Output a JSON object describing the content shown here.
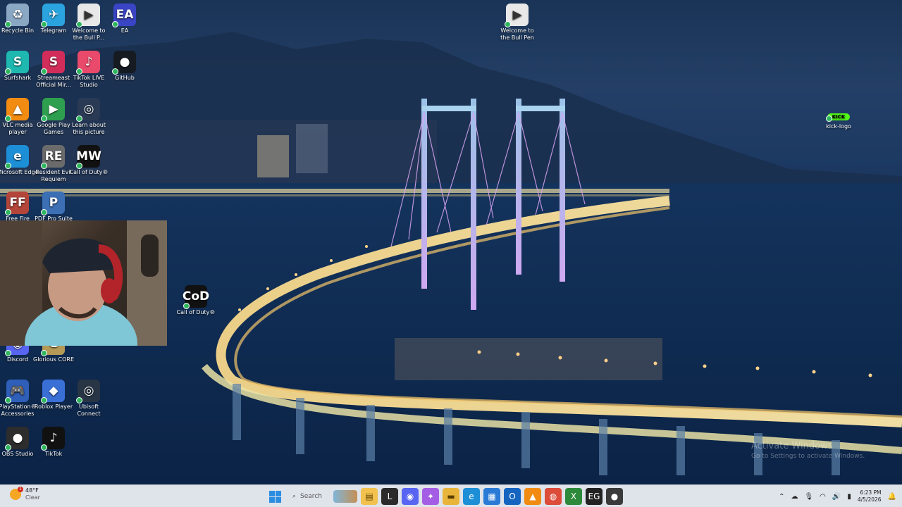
{
  "desktop": {
    "icons": [
      {
        "label": "Recycle Bin",
        "icon": "recycle-bin-icon",
        "color": "#8aa7c4",
        "glyph": "♻"
      },
      {
        "label": "Telegram",
        "icon": "telegram-icon",
        "color": "#2aa3df",
        "glyph": "✈"
      },
      {
        "label": "Welcome to the Bull P...",
        "icon": "video-file-icon",
        "color": "#e8e8e8",
        "glyph": "▶"
      },
      {
        "label": "EA",
        "icon": "ea-icon",
        "color": "#3a45c6",
        "glyph": "EA"
      },
      {
        "label": "Surfshark",
        "icon": "surfshark-icon",
        "color": "#1eb8b0",
        "glyph": "S"
      },
      {
        "label": "Streameast Official Mir...",
        "icon": "streameast-icon",
        "color": "#d22d5a",
        "glyph": "S"
      },
      {
        "label": "TikTok LIVE Studio",
        "icon": "tiktok-live-icon",
        "color": "#e9496a",
        "glyph": "♪"
      },
      {
        "label": "GitHub",
        "icon": "github-icon",
        "color": "#161b22",
        "glyph": "●"
      },
      {
        "label": "VLC media player",
        "icon": "vlc-icon",
        "color": "#f18b12",
        "glyph": "▲"
      },
      {
        "label": "Google Play Games",
        "icon": "google-play-games-icon",
        "color": "#2e9f4f",
        "glyph": "▶"
      },
      {
        "label": "Learn about this picture",
        "icon": "learn-picture-icon",
        "color": "#2a3a55",
        "glyph": "◎"
      },
      {
        "label": "Microsoft Edge",
        "icon": "edge-icon",
        "color": "#1c8fd6",
        "glyph": "e"
      },
      {
        "label": "Resident Evil Requiem",
        "icon": "resident-evil-icon",
        "color": "#6b6b6b",
        "glyph": "RE"
      },
      {
        "label": "Call of Duty®",
        "icon": "call-of-duty-icon",
        "color": "#111111",
        "glyph": "MW"
      },
      {
        "label": "Free Fire",
        "icon": "free-fire-icon",
        "color": "#b3453a",
        "glyph": "FF"
      },
      {
        "label": "PDF Pro Suite",
        "icon": "pdf-pro-icon",
        "color": "#3c6fb4",
        "glyph": "P"
      },
      {
        "label": "Discord",
        "icon": "discord-icon",
        "color": "#5865f2",
        "glyph": "◉"
      },
      {
        "label": "Glorious CORE",
        "icon": "glorious-core-icon",
        "color": "#b49a56",
        "glyph": "G"
      },
      {
        "label": "PlayStation® Accessories",
        "icon": "playstation-icon",
        "color": "#2f5fb8",
        "glyph": "🎮"
      },
      {
        "label": "Roblox Player",
        "icon": "roblox-icon",
        "color": "#3a6fd6",
        "glyph": "◆"
      },
      {
        "label": "Ubisoft Connect",
        "icon": "ubisoft-icon",
        "color": "#283545",
        "glyph": "◎"
      },
      {
        "label": "OBS Studio",
        "icon": "obs-icon",
        "color": "#2d2d2d",
        "glyph": "●"
      },
      {
        "label": "TikTok",
        "icon": "tiktok-icon",
        "color": "#111111",
        "glyph": "♪"
      },
      {
        "label": "Call of Duty®",
        "icon": "call-of-duty-icon",
        "color": "#111111",
        "glyph": "CoD"
      },
      {
        "label": "Welcome to the Bull Pen",
        "icon": "video-file-icon",
        "color": "#e8e8e8",
        "glyph": "▶"
      },
      {
        "label": "kick-logo",
        "icon": "kick-logo-icon",
        "color": "#53fc18",
        "glyph": "KICK"
      }
    ]
  },
  "watermark": {
    "line1": "Activate Windows",
    "line2": "Go to Settings to activate Windows."
  },
  "taskbar": {
    "weather": {
      "temp": "48°F",
      "condition": "Clear",
      "badge": "1"
    },
    "search_placeholder": "Search",
    "apps": [
      {
        "icon": "file-explorer-icon",
        "color": "#f2c14e",
        "glyph": "▤"
      },
      {
        "icon": "terminal-icon",
        "color": "#2b2b2b",
        "glyph": "L"
      },
      {
        "icon": "discord-icon",
        "color": "#5865f2",
        "glyph": "◉"
      },
      {
        "icon": "copilot-icon",
        "color": "#a45ee5",
        "glyph": "✦"
      },
      {
        "icon": "folder-icon",
        "color": "#e8b43a",
        "glyph": "▬"
      },
      {
        "icon": "edge-icon",
        "color": "#1c8fd6",
        "glyph": "e"
      },
      {
        "icon": "store-icon",
        "color": "#2a7bd6",
        "glyph": "▦"
      },
      {
        "icon": "outlook-icon",
        "color": "#1565c0",
        "glyph": "O"
      },
      {
        "icon": "vlc-icon",
        "color": "#f18b12",
        "glyph": "▲"
      },
      {
        "icon": "chrome-icon",
        "color": "#dd4b39",
        "glyph": "◍"
      },
      {
        "icon": "xbox-icon",
        "color": "#2d8a3a",
        "glyph": "X"
      },
      {
        "icon": "epic-games-icon",
        "color": "#222222",
        "glyph": "EG"
      },
      {
        "icon": "davinci-icon",
        "color": "#3a3a3a",
        "glyph": "●"
      }
    ],
    "clock": {
      "time": "6:23 PM",
      "date": "4/5/2026"
    }
  }
}
